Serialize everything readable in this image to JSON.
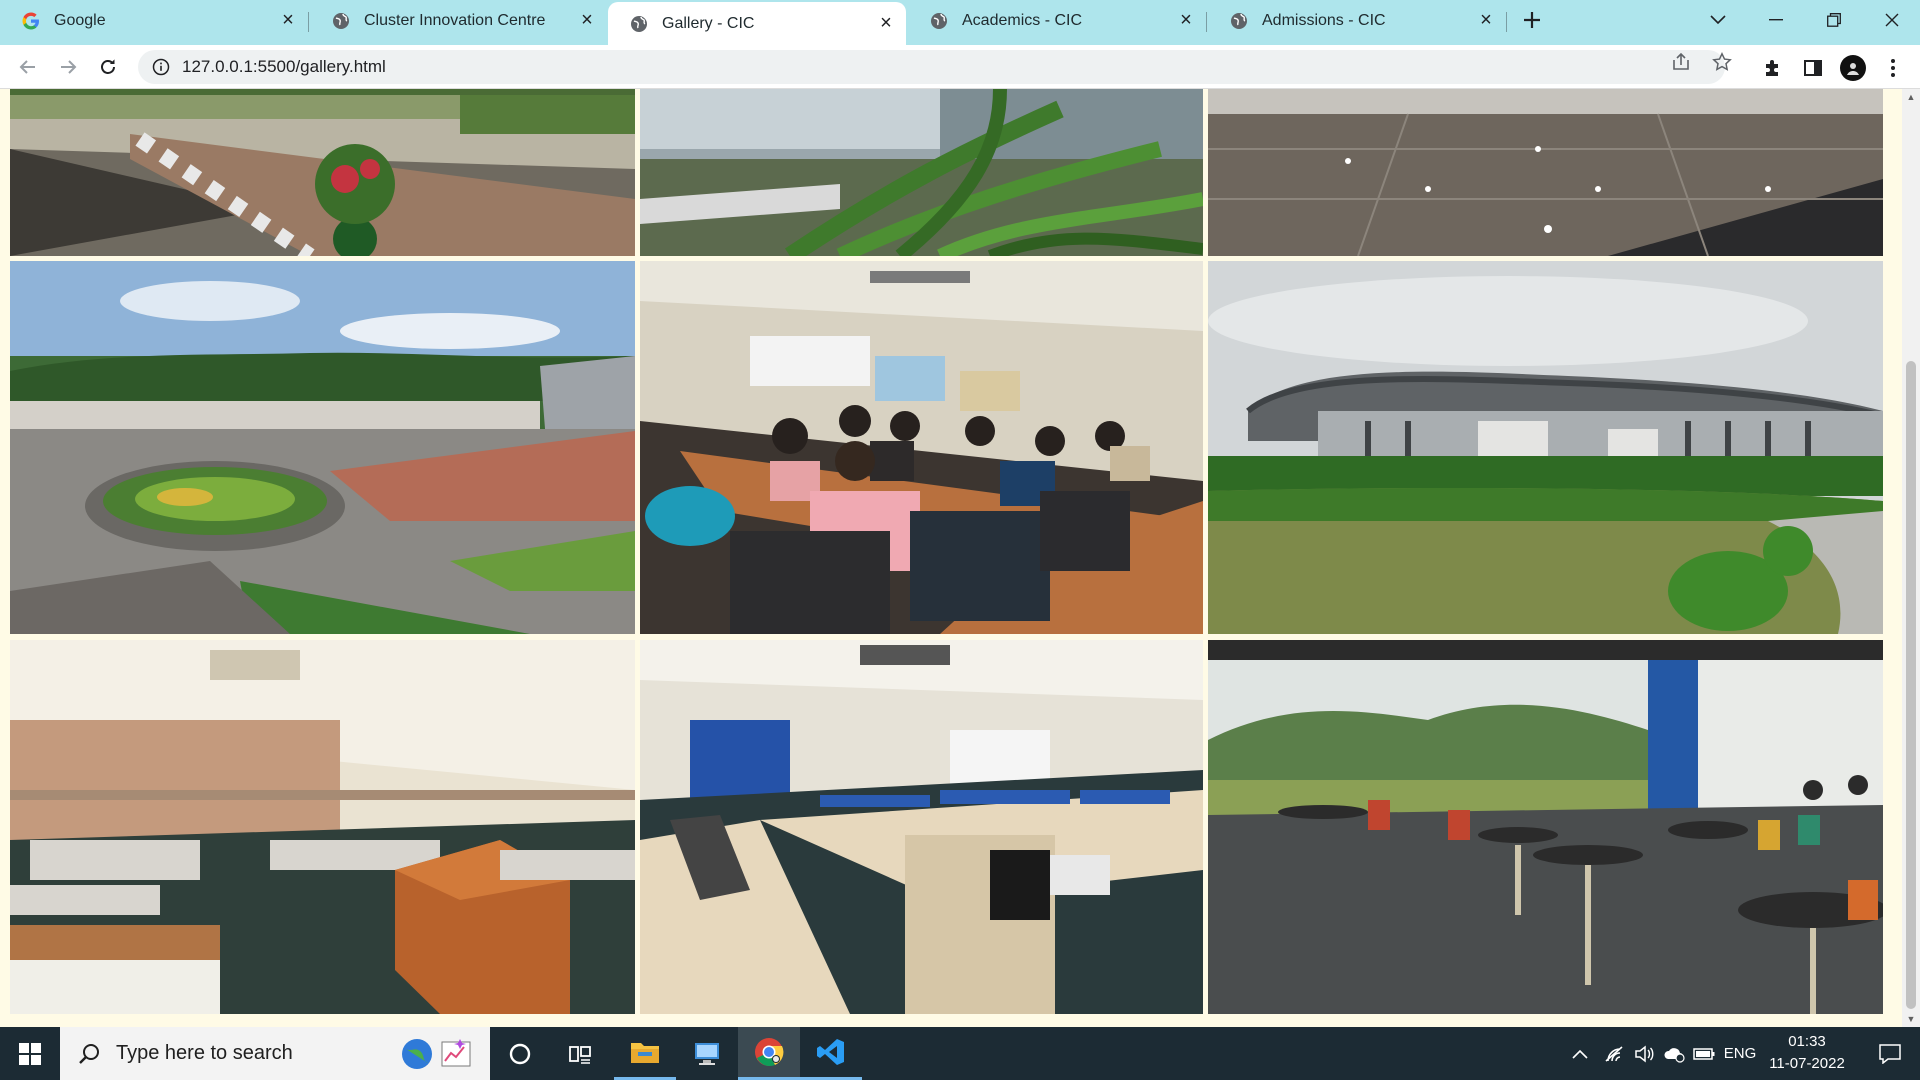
{
  "browser": {
    "tabs": [
      {
        "title": "Google",
        "favicon": "google-icon",
        "active": false
      },
      {
        "title": "Cluster Innovation Centre",
        "favicon": "globe-icon",
        "active": false
      },
      {
        "title": "Gallery - CIC",
        "favicon": "globe-icon",
        "active": true
      },
      {
        "title": "Academics - CIC",
        "favicon": "globe-icon",
        "active": false
      },
      {
        "title": "Admissions - CIC",
        "favicon": "globe-icon",
        "active": false
      }
    ],
    "new_tab_icon": "plus-icon",
    "window_controls": [
      "chevron-down-icon",
      "minimize-icon",
      "restore-icon",
      "close-icon"
    ],
    "toolbar": {
      "nav_icons": [
        "back-arrow-icon",
        "forward-arrow-icon",
        "reload-icon"
      ],
      "url": "127.0.0.1:5500/gallery.html",
      "omnibox_icons": [
        "share-icon",
        "star-icon"
      ],
      "right_icons": [
        "extensions-puzzle-icon",
        "side-panel-icon",
        "profile-avatar",
        "kebab-menu-icon"
      ]
    }
  },
  "page": {
    "background": "#fffbe6",
    "gallery": {
      "rows": 3,
      "columns": 3,
      "photos": [
        {
          "subject": "campus-road-with-planters"
        },
        {
          "subject": "bamboo-plants-near-building"
        },
        {
          "subject": "polished-granite-lobby-floor"
        },
        {
          "subject": "aerial-campus-roundabout-garden"
        },
        {
          "subject": "classroom-students-lecture"
        },
        {
          "subject": "university-stadium-exterior-lawn"
        },
        {
          "subject": "empty-lecture-hall-podium"
        },
        {
          "subject": "computer-lab-workstations"
        },
        {
          "subject": "cafeteria-glass-wall-view"
        }
      ]
    }
  },
  "taskbar": {
    "search_placeholder": "Type here to search",
    "apps": [
      "windows-start-icon",
      "cortana-circle-icon",
      "task-view-icon",
      "file-explorer-icon",
      "pc-icon",
      "chrome-icon",
      "vscode-icon"
    ],
    "tray": {
      "language": "ENG",
      "time": "01:33",
      "date": "11-07-2022"
    }
  }
}
